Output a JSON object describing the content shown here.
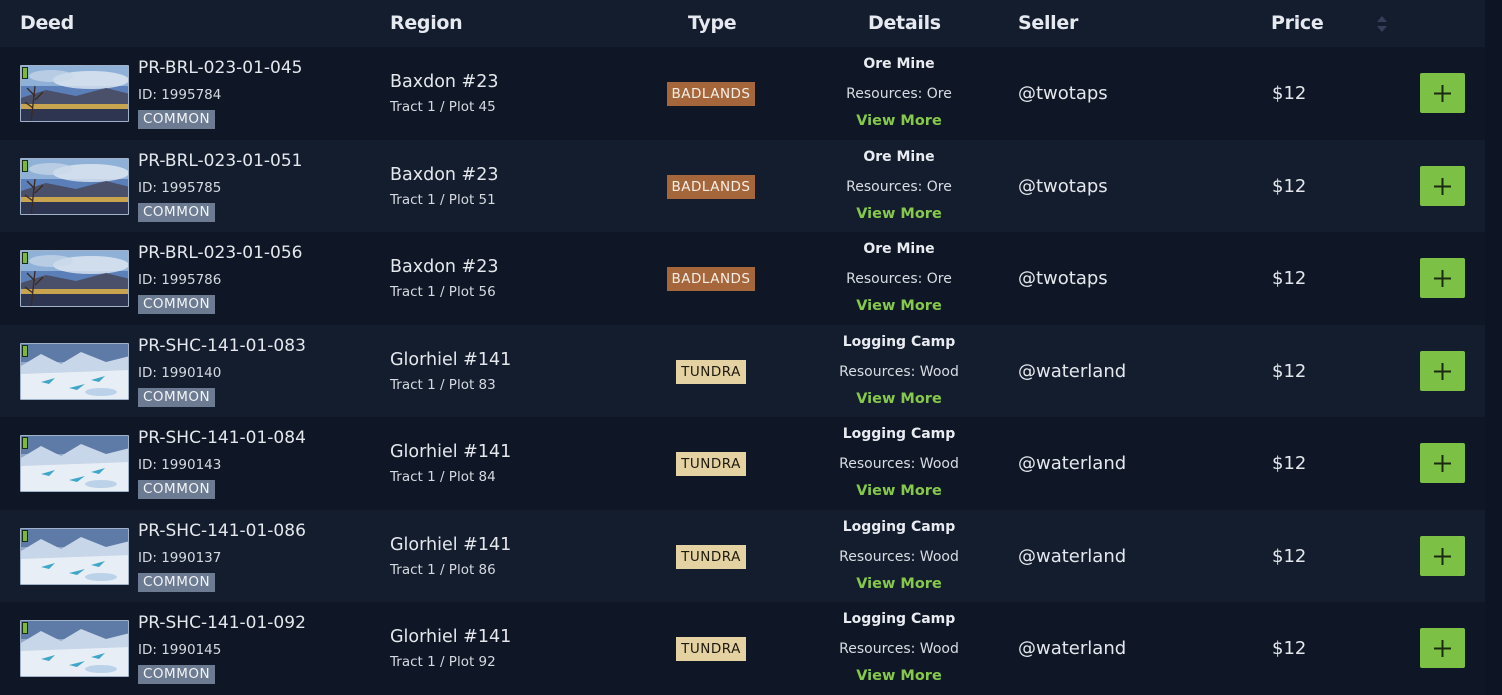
{
  "columns": {
    "deed": "Deed",
    "region": "Region",
    "type": "Type",
    "details": "Details",
    "seller": "Seller",
    "price": "Price"
  },
  "colors": {
    "badlands": "#a4663a",
    "tundra": "#e4d2a2",
    "accent_green": "#7cc146",
    "view_more": "#86c94a",
    "rarity_common": "#6c7b91"
  },
  "rows": [
    {
      "deed_name": "PR-BRL-023-01-045",
      "deed_id": "ID: 1995784",
      "rarity": "COMMON",
      "region_name": "Baxdon #23",
      "plot": "Tract 1 / Plot 45",
      "type": "BADLANDS",
      "type_key": "badlands",
      "detail_title": "Ore Mine",
      "resources": "Resources: Ore",
      "view_more": "View More",
      "seller": "@twotaps",
      "price": "$12",
      "icon": "plus-icon"
    },
    {
      "deed_name": "PR-BRL-023-01-051",
      "deed_id": "ID: 1995785",
      "rarity": "COMMON",
      "region_name": "Baxdon #23",
      "plot": "Tract 1 / Plot 51",
      "type": "BADLANDS",
      "type_key": "badlands",
      "detail_title": "Ore Mine",
      "resources": "Resources: Ore",
      "view_more": "View More",
      "seller": "@twotaps",
      "price": "$12",
      "icon": "plus-icon"
    },
    {
      "deed_name": "PR-BRL-023-01-056",
      "deed_id": "ID: 1995786",
      "rarity": "COMMON",
      "region_name": "Baxdon #23",
      "plot": "Tract 1 / Plot 56",
      "type": "BADLANDS",
      "type_key": "badlands",
      "detail_title": "Ore Mine",
      "resources": "Resources: Ore",
      "view_more": "View More",
      "seller": "@twotaps",
      "price": "$12",
      "icon": "plus-icon"
    },
    {
      "deed_name": "PR-SHC-141-01-083",
      "deed_id": "ID: 1990140",
      "rarity": "COMMON",
      "region_name": "Glorhiel #141",
      "plot": "Tract 1 / Plot 83",
      "type": "TUNDRA",
      "type_key": "tundra",
      "detail_title": "Logging Camp",
      "resources": "Resources: Wood",
      "view_more": "View More",
      "seller": "@waterland",
      "price": "$12",
      "icon": "plus-icon"
    },
    {
      "deed_name": "PR-SHC-141-01-084",
      "deed_id": "ID: 1990143",
      "rarity": "COMMON",
      "region_name": "Glorhiel #141",
      "plot": "Tract 1 / Plot 84",
      "type": "TUNDRA",
      "type_key": "tundra",
      "detail_title": "Logging Camp",
      "resources": "Resources: Wood",
      "view_more": "View More",
      "seller": "@waterland",
      "price": "$12",
      "icon": "plus-icon"
    },
    {
      "deed_name": "PR-SHC-141-01-086",
      "deed_id": "ID: 1990137",
      "rarity": "COMMON",
      "region_name": "Glorhiel #141",
      "plot": "Tract 1 / Plot 86",
      "type": "TUNDRA",
      "type_key": "tundra",
      "detail_title": "Logging Camp",
      "resources": "Resources: Wood",
      "view_more": "View More",
      "seller": "@waterland",
      "price": "$12",
      "icon": "plus-icon"
    },
    {
      "deed_name": "PR-SHC-141-01-092",
      "deed_id": "ID: 1990145",
      "rarity": "COMMON",
      "region_name": "Glorhiel #141",
      "plot": "Tract 1 / Plot 92",
      "type": "TUNDRA",
      "type_key": "tundra",
      "detail_title": "Logging Camp",
      "resources": "Resources: Wood",
      "view_more": "View More",
      "seller": "@waterland",
      "price": "$12",
      "icon": "plus-icon"
    }
  ]
}
